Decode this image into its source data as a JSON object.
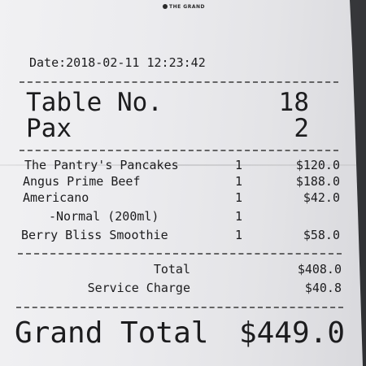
{
  "receipt": {
    "logo_text": "THE GRAND",
    "date_label": "Date:",
    "date_value": "2018-02-11 12:23:42",
    "table_label": "Table No.",
    "table_value": "18",
    "pax_label": "Pax",
    "pax_value": "2",
    "items": [
      {
        "name": "The Pantry's Pancakes",
        "qty": "1",
        "price": "$120.0"
      },
      {
        "name": "Angus Prime Beef",
        "qty": "1",
        "price": "$188.0"
      },
      {
        "name": "Americano",
        "qty": "1",
        "price": "$42.0"
      },
      {
        "name": "-Normal (200ml)",
        "qty": "1",
        "price": ""
      },
      {
        "name": "Berry Bliss Smoothie",
        "qty": "1",
        "price": "$58.0"
      }
    ],
    "total_label": "Total",
    "total_value": "$408.0",
    "service_label": "Service Charge",
    "service_value": "$40.8",
    "grand_total_label": "Grand Total",
    "grand_total_value": "$449.0"
  }
}
